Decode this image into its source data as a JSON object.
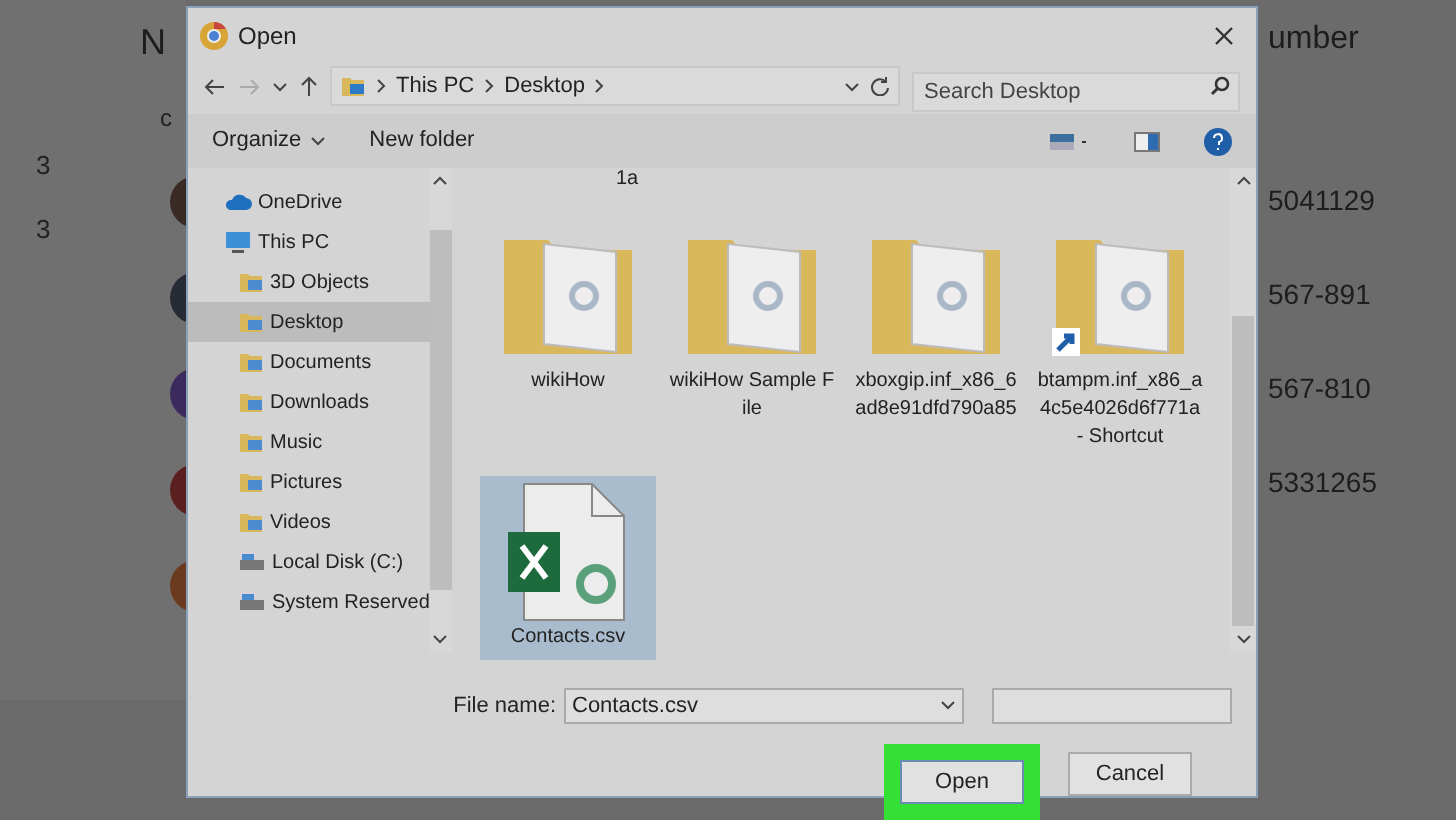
{
  "background": {
    "header_left": "N",
    "header_right": "umber",
    "subheader": "c",
    "counts": [
      "3",
      "3"
    ],
    "avatars": [
      {
        "color": "#3a2a26"
      },
      {
        "color": "#262b36"
      },
      {
        "color": "#3b2a5c"
      },
      {
        "color": "#5c1f1f"
      },
      {
        "color": "#6b3a1f"
      }
    ],
    "numbers": [
      "5041129",
      "567-891",
      "567-810",
      "5331265"
    ]
  },
  "dialog": {
    "title": "Open",
    "breadcrumb": [
      "This PC",
      "Desktop"
    ],
    "search": {
      "placeholder": "Search Desktop"
    },
    "toolbar": [
      "Organize",
      "New folder"
    ],
    "nav": [
      {
        "label": "OneDrive",
        "kind": "cloud",
        "selected": false
      },
      {
        "label": "This PC",
        "kind": "pc",
        "selected": false
      },
      {
        "label": "3D Objects",
        "kind": "folder",
        "selected": false
      },
      {
        "label": "Desktop",
        "kind": "folder",
        "selected": true
      },
      {
        "label": "Documents",
        "kind": "folder",
        "selected": false
      },
      {
        "label": "Downloads",
        "kind": "folder",
        "selected": false
      },
      {
        "label": "Music",
        "kind": "folder",
        "selected": false
      },
      {
        "label": "Pictures",
        "kind": "folder",
        "selected": false
      },
      {
        "label": "Videos",
        "kind": "folder",
        "selected": false
      },
      {
        "label": "Local Disk (C:)",
        "kind": "disk",
        "selected": false
      },
      {
        "label": "System Reserved",
        "kind": "disk",
        "selected": false
      }
    ],
    "cut_label": "1a",
    "files": [
      {
        "name": "wikiHow",
        "kind": "folder",
        "selected": false
      },
      {
        "name": "wikiHow Sample File",
        "kind": "folder",
        "selected": false
      },
      {
        "name": "xboxgip.inf_x86_6ad8e91dfd790a85",
        "kind": "folder",
        "selected": false
      },
      {
        "name": "btampm.inf_x86_a4c5e4026d6f771a - Shortcut",
        "kind": "shortcut",
        "selected": false
      },
      {
        "name": "Contacts.csv",
        "kind": "csv",
        "selected": true
      }
    ],
    "file_name_label": "File name:",
    "file_name": "Contacts.csv",
    "buttons": [
      "Open",
      "Cancel"
    ]
  }
}
